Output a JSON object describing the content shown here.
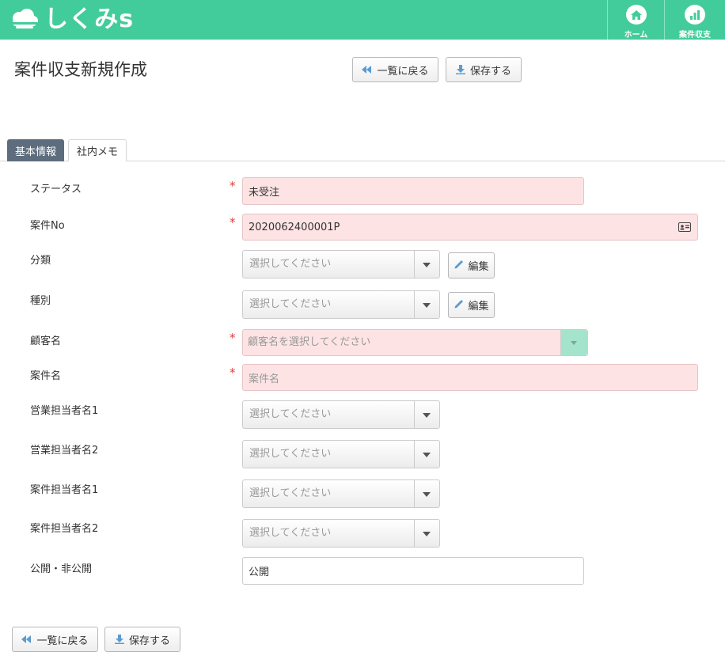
{
  "header": {
    "logo_text": "しくみs",
    "nav": [
      {
        "label": "ホーム",
        "icon": "home-icon"
      },
      {
        "label": "案件収支",
        "icon": "chart-icon"
      }
    ],
    "color": "#43cc9b"
  },
  "page": {
    "title": "案件収支新規作成",
    "back_label": "一覧に戻る",
    "save_label": "保存する"
  },
  "tabs": [
    {
      "label": "基本情報",
      "active": true
    },
    {
      "label": "社内メモ",
      "active": false
    }
  ],
  "form": {
    "status": {
      "label": "ステータス",
      "value": "未受注"
    },
    "case_no": {
      "label": "案件No",
      "value": "2020062400001P"
    },
    "category": {
      "label": "分類",
      "placeholder": "選択してください"
    },
    "kind": {
      "label": "種別",
      "placeholder": "選択してください"
    },
    "edit_label": "編集",
    "customer": {
      "label": "顧客名",
      "placeholder": "顧客名を選択してください"
    },
    "case_name": {
      "label": "案件名",
      "placeholder": "案件名"
    },
    "sales1": {
      "label": "営業担当者名1",
      "placeholder": "選択してください"
    },
    "sales2": {
      "label": "営業担当者名2",
      "placeholder": "選択してください"
    },
    "case1": {
      "label": "案件担当者名1",
      "placeholder": "選択してください"
    },
    "case2": {
      "label": "案件担当者名2",
      "placeholder": "選択してください"
    },
    "publicity": {
      "label": "公開・非公開",
      "value": "公開"
    },
    "required_mark": "*"
  }
}
